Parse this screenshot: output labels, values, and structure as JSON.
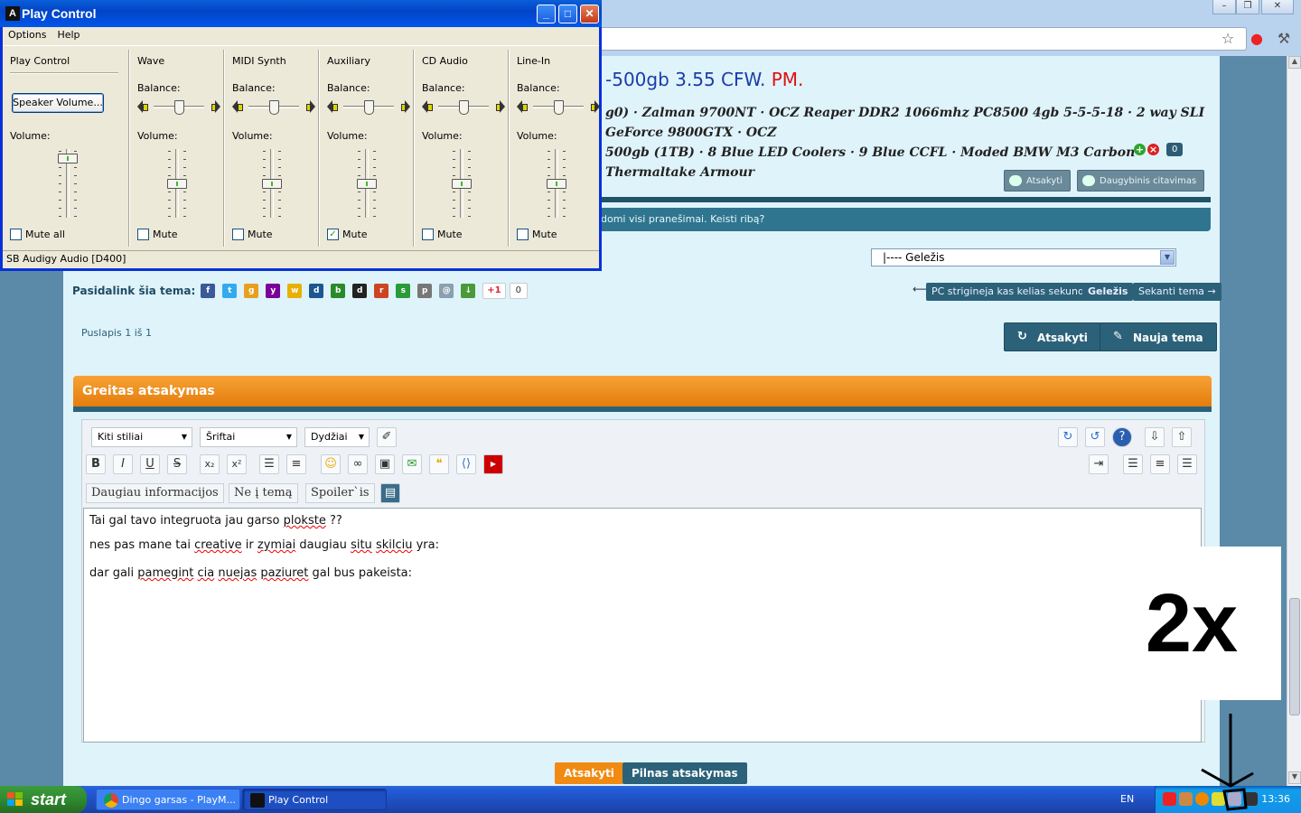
{
  "browser": {
    "window_controls": [
      "–",
      "❐",
      "✕"
    ]
  },
  "post": {
    "title_text": "-500gb 3.55 CFW.",
    "title_pm": "PM.",
    "signature_line1": "g0) · Zalman 9700NT · OCZ Reaper DDR2 1066mhz PC8500 4gb 5-5-5-18 · 2 way SLI GeForce 9800GTX · OCZ",
    "signature_line2": "500gb (1TB) · 8 Blue LED Coolers · 9 Blue CCFL · Moded BMW M3 Carbon Thermaltake Armour",
    "rating_count": "0",
    "reply_label": "Atsakyti",
    "multiquote_label": "Daugybinis citavimas"
  },
  "notice": "domi visi pranešimai. Keisti ribą?",
  "forum_select": "|---- Geležis",
  "share": {
    "label": "Pasidalink šia tema:",
    "gplus": "+1",
    "gcount": "0",
    "icons": [
      {
        "name": "facebook-icon",
        "glyph": "f",
        "color": "#3b5998"
      },
      {
        "name": "twitter-icon",
        "glyph": "t",
        "color": "#33aaf0"
      },
      {
        "name": "google-icon",
        "glyph": "g",
        "color": "#e8a020"
      },
      {
        "name": "yahoo-icon",
        "glyph": "y",
        "color": "#7b0099"
      },
      {
        "name": "windows-live-icon",
        "glyph": "w",
        "color": "#e8b000"
      },
      {
        "name": "digg-icon",
        "glyph": "d",
        "color": "#1b5791"
      },
      {
        "name": "buzz-icon",
        "glyph": "b",
        "color": "#2a8a2a"
      },
      {
        "name": "delicious-icon",
        "glyph": "d",
        "color": "#222222"
      },
      {
        "name": "reddit-icon",
        "glyph": "r",
        "color": "#cc4422"
      },
      {
        "name": "stumbleupon-icon",
        "glyph": "s",
        "color": "#2a9a3a"
      },
      {
        "name": "print-icon",
        "glyph": "p",
        "color": "#777777"
      },
      {
        "name": "email-icon",
        "glyph": "@",
        "color": "#8aa0b0"
      },
      {
        "name": "download-icon",
        "glyph": "↓",
        "color": "#4a9a3a"
      }
    ]
  },
  "topic_nav": {
    "prev": "PC strigineja kas kelias sekundes",
    "current": "Geležis",
    "next": "Sekanti tema →",
    "arrow": "⟵"
  },
  "pager": "Puslapis 1 iš 1",
  "actions": {
    "reply": "Atsakyti",
    "new_topic": "Nauja tema"
  },
  "quick_reply": {
    "title": "Greitas atsakymas",
    "style_select": "Kiti stiliai",
    "font_select": "Šriftai",
    "size_select": "Dydžiai",
    "custom_btn1": "Daugiau informacijos",
    "custom_btn2": "Ne į temą",
    "custom_btn3": "Spoiler`is",
    "text_line1_a": "Tai gal tavo integruota jau garso ",
    "text_line1_sp": "plokste",
    "text_line1_b": " ??",
    "text_line2_a": "nes pas mane tai ",
    "text_line2_sp1": "creative",
    "text_line2_b": " ir ",
    "text_line2_sp2": "zymiai",
    "text_line2_c": " daugiau ",
    "text_line2_sp3": "situ",
    "text_line2_d": " ",
    "text_line2_sp4": "skilciu",
    "text_line2_e": " yra:",
    "text_line3_a": "dar gali ",
    "text_line3_sp1": "pamegint",
    "text_line3_b": " ",
    "text_line3_sp2": "cia",
    "text_line3_c": " ",
    "text_line3_sp3": "nuejas",
    "text_line3_d": " ",
    "text_line3_sp4": "paziuret",
    "text_line3_e": " gal bus pakeista:",
    "submit": "Atsakyti",
    "full_reply": "Pilnas atsakymas"
  },
  "overlay_text": "2x",
  "play_control": {
    "title": "Play Control",
    "menu": [
      "Options",
      "Help"
    ],
    "status": "SB Audigy Audio [D400]",
    "speaker_button": "Speaker Volume...",
    "master": {
      "title": "Play Control",
      "volume_label": "Volume:",
      "mute_label": "Mute all",
      "muted": false,
      "volume": 0.92
    },
    "channels": [
      {
        "title": "Wave",
        "balance_label": "Balance:",
        "volume_label": "Volume:",
        "mute_label": "Mute",
        "muted": false,
        "balance": 0.5,
        "volume": 0.5
      },
      {
        "title": "MIDI Synth",
        "balance_label": "Balance:",
        "volume_label": "Volume:",
        "mute_label": "Mute",
        "muted": false,
        "balance": 0.5,
        "volume": 0.5
      },
      {
        "title": "Auxiliary",
        "balance_label": "Balance:",
        "volume_label": "Volume:",
        "mute_label": "Mute",
        "muted": true,
        "balance": 0.5,
        "volume": 0.5
      },
      {
        "title": "CD Audio",
        "balance_label": "Balance:",
        "volume_label": "Volume:",
        "mute_label": "Mute",
        "muted": false,
        "balance": 0.5,
        "volume": 0.5
      },
      {
        "title": "Line-In",
        "balance_label": "Balance:",
        "volume_label": "Volume:",
        "mute_label": "Mute",
        "muted": false,
        "balance": 0.5,
        "volume": 0.5
      }
    ]
  },
  "taskbar": {
    "start": "start",
    "tasks": [
      {
        "label": "Dingo garsas - PlayM...",
        "icon": "chrome-icon"
      },
      {
        "label": "Play Control",
        "icon": "play-control-icon"
      }
    ],
    "language": "EN",
    "clock": "13:36"
  }
}
